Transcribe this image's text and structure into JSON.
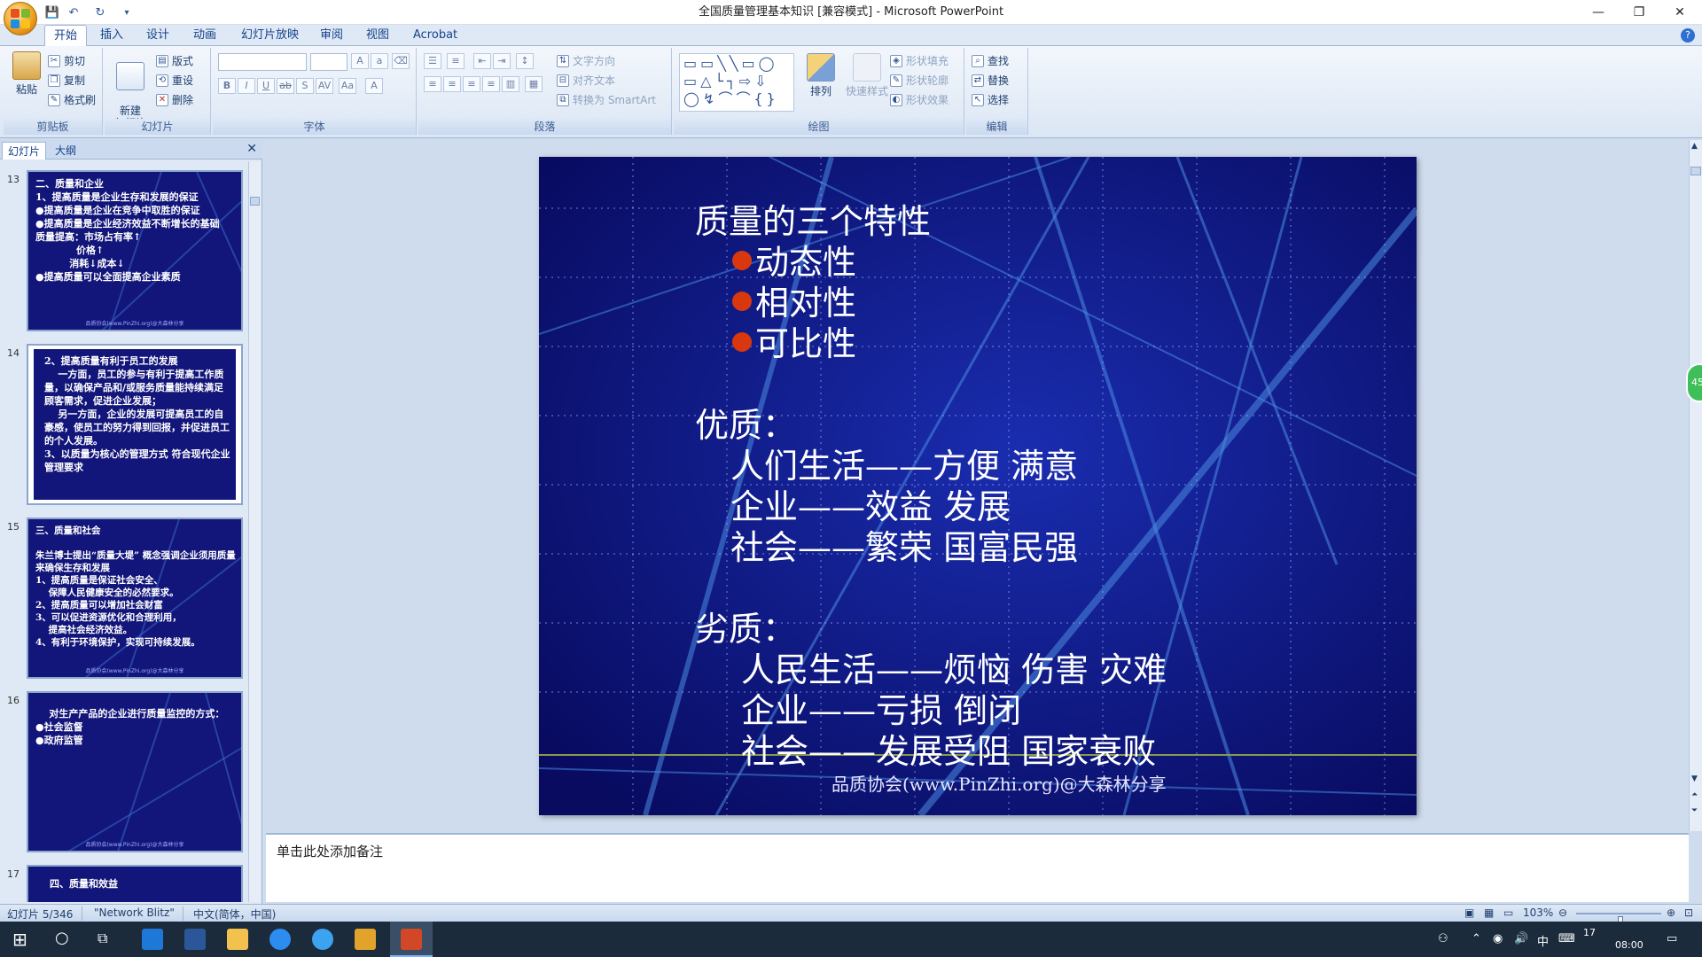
{
  "window": {
    "title": "全国质量管理基本知识 [兼容模式] - Microsoft PowerPoint",
    "min": "—",
    "max": "❐",
    "close": "✕"
  },
  "ribbon_tabs": [
    "开始",
    "插入",
    "设计",
    "动画",
    "幻灯片放映",
    "审阅",
    "视图",
    "Acrobat"
  ],
  "ribbon": {
    "clipboard": {
      "paste": "粘贴",
      "cut": "剪切",
      "copy": "复制",
      "format_painter": "格式刷",
      "label": "剪贴板"
    },
    "slides": {
      "new_slide": "新建\n幻灯片",
      "layout": "版式",
      "reset": "重设",
      "delete": "删除",
      "label": "幻灯片"
    },
    "font": {
      "label": "字体"
    },
    "paragraph": {
      "text_direction": "文字方向",
      "align_text": "对齐文本",
      "smartart": "转换为 SmartArt",
      "label": "段落"
    },
    "drawing": {
      "arrange": "排列",
      "quick_styles": "快速样式",
      "shape_fill": "形状填充",
      "shape_outline": "形状轮廓",
      "shape_effects": "形状效果",
      "label": "绘图"
    },
    "editing": {
      "find": "查找",
      "replace": "替换",
      "select": "选择",
      "label": "编辑"
    }
  },
  "pane_tabs": [
    "幻灯片",
    "大纲"
  ],
  "thumbnails": [
    {
      "num": "13",
      "text": "二、质量和企业\n1、提高质量是企业生存和发展的保证\n●提高质量是企业在竞争中取胜的保证\n●提高质量是企业经济效益不断增长的基础\n质量提高：市场占有率↑\n            价格↑\n          消耗↓成本↓\n●提高质量可以全面提高企业素质"
    },
    {
      "num": "14",
      "text": "2、提高质量有利于员工的发展\n    一方面，员工的参与有利于提高工作质量，以确保产品和/或服务质量能持续满足顾客需求，促进企业发展；\n    另一方面，企业的发展可提高员工的自豪感，使员工的努力得到回报，并促进员工的个人发展。\n3、以质量为核心的管理方式 符合现代企业管理要求"
    },
    {
      "num": "15",
      "text": "三、质量和社会\n\n朱兰博士提出“质量大堤” 概念强调企业须用质量来确保生存和发展\n1、提高质量是保证社会安全、\n    保障人民健康安全的必然要求。\n2、提高质量可以增加社会财富\n3、可以促进资源优化和合理利用，\n    提高社会经济效益。\n4、有利于环境保护，实现可持续发展。"
    },
    {
      "num": "16",
      "text": "    对生产产品的企业进行质量监控的方式：\n●社会监督\n●政府监管"
    },
    {
      "num": "17",
      "text": "四、质量和效益"
    }
  ],
  "thumb_footer": "品质协会(www.PinZhi.org)@大森林分享",
  "slide": {
    "heading": "质量的三个特性",
    "bullets": [
      "动态性",
      "相对性",
      "可比性"
    ],
    "good_title": "优质：",
    "good_lines": [
      "人们生活——方便 满意",
      "企业——效益 发展",
      "社会——繁荣 国富民强"
    ],
    "bad_title": "劣质：",
    "bad_lines": [
      "人民生活——烦恼 伤害 灾难",
      "企业——亏损 倒闭",
      "社会——发展受阻 国家衰败"
    ],
    "footer": "品质协会(www.PinZhi.org)@大森林分享",
    "colors": {
      "background": "#0b0f72",
      "bullet": "#d9380f",
      "text": "#ffffff"
    }
  },
  "notes_placeholder": "单击此处添加备注",
  "statusbar": {
    "slide_count": "幻灯片 5/346",
    "theme": "\"Network Blitz\"",
    "language": "中文(简体，中国)",
    "zoom": "103%",
    "zoom_fraction": 0.52
  },
  "taskbar": {
    "tray_ime": "中",
    "tray_time": "08:00",
    "tray_date": "17"
  }
}
